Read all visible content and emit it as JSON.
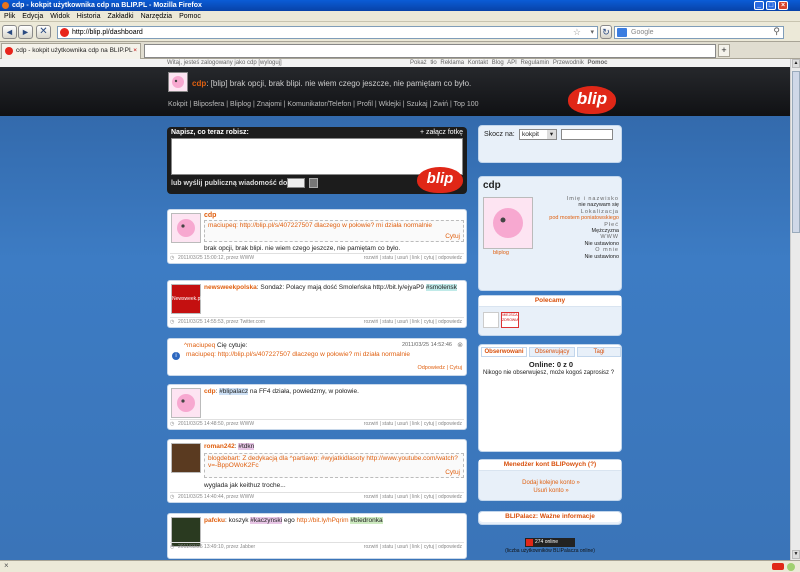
{
  "window": {
    "title": "cdp - kokpit użytkownika cdp na BLIP.PL - Mozilla Firefox"
  },
  "menu": [
    "Plik",
    "Edycja",
    "Widok",
    "Historia",
    "Zakładki",
    "Narzędzia",
    "Pomoc"
  ],
  "nav": {
    "url": "http://blip.pl/dashboard",
    "search_placeholder": "Google"
  },
  "tabs": [
    {
      "label": "cdp - kokpit użytkownika cdp na BLIP.PL"
    }
  ],
  "header": {
    "login_text": "Witaj, jesteś zalogowany jako cdp [wyloguj]",
    "top_links": [
      "Pokaż tło",
      "Reklama",
      "Kontakt",
      "Blog",
      "API",
      "Regulamin",
      "Przewodnik",
      "Pomoc"
    ],
    "user": "cdp",
    "status_text": "[blip] brak opcji, brak blipi. nie wiem czego jeszcze, nie pamiętam co było.",
    "nav_tabs": [
      "Kokpit",
      "Bliposfera",
      "Bliplog",
      "Znajomi",
      "Komunikator/Telefon",
      "Profil",
      "Wklejki",
      "Szukaj",
      "Zwiń",
      "Top 100"
    ],
    "logo": "blip"
  },
  "compose": {
    "label": "Napisz, co teraz robisz:",
    "attach_label": "+ załącz fotkę",
    "private_label": "lub wyślij publiczną wiadomość do:",
    "logo": "blip"
  },
  "posts": [
    {
      "user": "cdp",
      "quote": "maciupeq: http://blip.pl/s/407227507 dlaczego w połowie? mi działa normalnie",
      "quote_cite": "Cytuj",
      "text": "brak opcji, brak blipi. nie wiem czego jeszcze, nie pamiętam co było.",
      "meta": "2011/03/25 15:00:12, przez WWW",
      "actions": "rozwiń | statu | usuń | link | cytuj | odpowiedz"
    },
    {
      "user": "newsweekpolska",
      "avatar_text": "Newsweek.pl",
      "text": "Sondaż: Polacy mają dość Smoleńska http://bit.ly/ejyaP9",
      "tag": "#smolensk",
      "meta": "2011/03/25 14:55:53, przez Twitter.com",
      "actions": "rozwiń | statu | usuń | link | cytuj | odpowiedz"
    },
    {
      "user": "^maciupeq",
      "text": "Cię cytuje:",
      "date": "2011/03/25 14:52:46",
      "quote": "maciupeq: http://blip.pl/s/407227507 dlaczego w połowie? mi działa normalnie",
      "actions": "Odpowiedz | Cytuj"
    },
    {
      "user": "cdp",
      "tag": "#blipalacz",
      "text": "na FF4 działa, powiedzmy, w połowie.",
      "meta": "2011/03/25 14:48:50, przez WWW",
      "actions": "rozwiń | statu | usuń | link | cytuj | odpowiedz"
    },
    {
      "user": "roman242",
      "tag": "#tdkn",
      "quote": "blogdebart: Z dedykacją dla ^partiawp: #wyjatkidlasoty http://www.youtube.com/watch?v=-BppOWoK2Fc",
      "quote_cite": "Cytuj",
      "text": "wyglada jak keithuz troche...",
      "meta": "2011/03/25 14:40:44, przez WWW",
      "actions": "rozwiń | statu | usuń | link | cytuj | odpowiedz"
    },
    {
      "user": "pafcku",
      "text_pre": "koszyk",
      "tag1": "#kaczynski",
      "text_mid": "ego",
      "link": "http://bit.ly/hPqrim",
      "tag2": "#biedronka",
      "meta": "2011/03/25 13:49:10, przez Jabber",
      "actions": "rozwiń | statu | usuń | link | cytuj | odpowiedz"
    }
  ],
  "sidebar": {
    "jump_label": "Skocz na:",
    "jump_value": "kokpit",
    "profile": {
      "name": "cdp",
      "fields": [
        {
          "label": "Imię i nazwisko",
          "value": "nie nazywam się"
        },
        {
          "label": "Lokalizacja",
          "value": "pod mostem poniatowskiego"
        },
        {
          "label": "Płeć",
          "value": "Mężczyzna"
        },
        {
          "label": "WWW",
          "value": "Nie ustawiono"
        },
        {
          "label": "O mnie",
          "value": "Nie ustawiono"
        }
      ],
      "bliplog_label": "bliplog"
    },
    "recommended": {
      "title": "Polecamy",
      "badge": "MIEJSCA ZDROWIA"
    },
    "tabs": [
      "Obserwowani",
      "Obserwujący",
      "Tagi"
    ],
    "online_label": "Online: 0 z 0",
    "online_text": "Nikogo nie obserwujesz, może kogoś zaprosisz ?",
    "invite_link": "zaprosisz",
    "manager": {
      "title": "Menedżer kont BLIPowych (?)",
      "links": [
        "Dodaj kolejne konto »",
        "Usuń konto »"
      ]
    },
    "blipalacz": {
      "title": "BLIPalacz: Ważne informacje",
      "badge": "274 online",
      "note": "(liczba użytkowników BLIPalacza online)"
    }
  },
  "colors": {
    "accent": "#e02717",
    "link": "#e06010",
    "titlebar": "#0a5cd6"
  }
}
